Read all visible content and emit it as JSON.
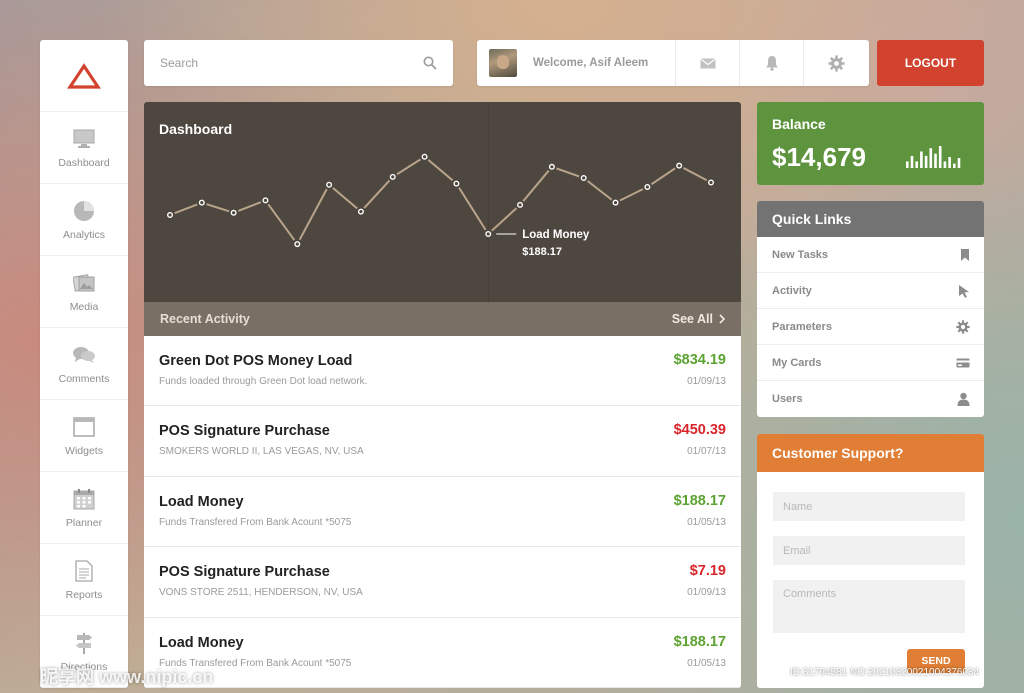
{
  "sidebar": {
    "items": [
      {
        "label": "Dashboard",
        "icon": "monitor-icon"
      },
      {
        "label": "Analytics",
        "icon": "pie-chart-icon"
      },
      {
        "label": "Media",
        "icon": "photos-icon"
      },
      {
        "label": "Comments",
        "icon": "speech-bubbles-icon"
      },
      {
        "label": "Widgets",
        "icon": "window-icon"
      },
      {
        "label": "Planner",
        "icon": "calendar-icon"
      },
      {
        "label": "Reports",
        "icon": "document-icon"
      },
      {
        "label": "Directions",
        "icon": "signpost-icon"
      }
    ]
  },
  "search": {
    "placeholder": "Search"
  },
  "header": {
    "welcome": "Welcome, Asif Aleem",
    "logout_label": "LOGOUT"
  },
  "dashboard": {
    "title": "Dashboard",
    "tooltip_label": "Load Money",
    "tooltip_value": "$188.17"
  },
  "chart_data": {
    "type": "line",
    "title": "Dashboard",
    "series": [
      {
        "values": [
          4.2,
          5.3,
          4.4,
          5.5,
          1.6,
          6.9,
          4.5,
          7.6,
          9.4,
          7.0,
          2.5,
          5.1,
          8.5,
          7.5,
          5.3,
          6.7,
          8.6,
          7.1
        ]
      }
    ],
    "highlight_index": 10,
    "ylim": [
      0,
      10
    ],
    "grid": false,
    "line_color": "#b7a48a",
    "marker_color": "#ffffff"
  },
  "recent": {
    "title": "Recent Activity",
    "see_all": "See All",
    "items": [
      {
        "title": "Green Dot POS Money Load",
        "subtitle": "Funds loaded through Green Dot load network.",
        "amount": "$834.19",
        "date": "01/09/13",
        "type": "credit"
      },
      {
        "title": "POS Signature Purchase",
        "subtitle": "SMOKERS WORLD II, LAS VEGAS, NV, USA",
        "amount": "$450.39",
        "date": "01/07/13",
        "type": "debit"
      },
      {
        "title": "Load Money",
        "subtitle": "Funds Transfered From Bank Acount *5075",
        "amount": "$188.17",
        "date": "01/05/13",
        "type": "credit"
      },
      {
        "title": "POS Signature Purchase",
        "subtitle": "VONS STORE 2511, HENDERSON, NV, USA",
        "amount": "$7.19",
        "date": "01/09/13",
        "type": "debit"
      },
      {
        "title": "Load Money",
        "subtitle": "Funds Transfered From Bank Acount *5075",
        "amount": "$188.17",
        "date": "01/05/13",
        "type": "credit"
      }
    ]
  },
  "balance": {
    "label": "Balance",
    "value": "$14,679",
    "bars": [
      0.3,
      0.55,
      0.3,
      0.75,
      0.55,
      0.9,
      0.65,
      1.0,
      0.3,
      0.5,
      0.2,
      0.45
    ]
  },
  "quick_links": {
    "title": "Quick Links",
    "items": [
      {
        "label": "New Tasks",
        "icon": "bookmark-icon"
      },
      {
        "label": "Activity",
        "icon": "cursor-icon"
      },
      {
        "label": "Parameters",
        "icon": "gear-icon"
      },
      {
        "label": "My Cards",
        "icon": "credit-card-icon"
      },
      {
        "label": "Users",
        "icon": "user-icon"
      }
    ]
  },
  "support": {
    "title": "Customer Support?",
    "name_placeholder": "Name",
    "email_placeholder": "Email",
    "comments_placeholder": "Comments",
    "send_label": "SEND"
  },
  "colors": {
    "credit": "#5da332",
    "debit": "#d8262c",
    "logout": "#d2432f",
    "balance": "#5f943f",
    "support": "#df7e34"
  },
  "watermark": "ID:31794581 NO:20210320021004376034",
  "brandmark": "昵享网 www.nipic.cn"
}
